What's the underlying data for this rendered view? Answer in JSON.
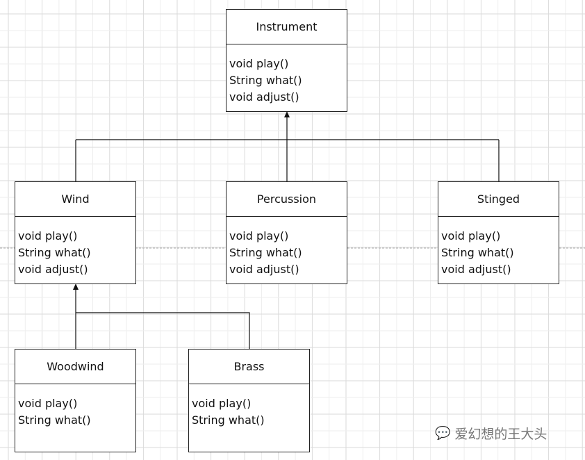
{
  "classes": [
    {
      "id": "instrument",
      "name": "Instrument",
      "methods": [
        "void play()",
        "String what()",
        "void adjust()"
      ]
    },
    {
      "id": "wind",
      "name": "Wind",
      "methods": [
        "void play()",
        "String what()",
        "void adjust()"
      ]
    },
    {
      "id": "percussion",
      "name": "Percussion",
      "methods": [
        "void play()",
        "String what()",
        "void adjust()"
      ]
    },
    {
      "id": "stinged",
      "name": "Stinged",
      "methods": [
        "void play()",
        "String what()",
        "void adjust()"
      ]
    },
    {
      "id": "woodwind",
      "name": "Woodwind",
      "methods": [
        "void play()",
        "String what()"
      ]
    },
    {
      "id": "brass",
      "name": "Brass",
      "methods": [
        "void play()",
        "String what()"
      ]
    }
  ],
  "relations": [
    {
      "from": "wind",
      "to": "instrument",
      "type": "inheritance"
    },
    {
      "from": "percussion",
      "to": "instrument",
      "type": "inheritance"
    },
    {
      "from": "stinged",
      "to": "instrument",
      "type": "inheritance"
    },
    {
      "from": "woodwind",
      "to": "wind",
      "type": "inheritance"
    },
    {
      "from": "brass",
      "to": "wind",
      "type": "inheritance"
    }
  ],
  "watermark": {
    "text": "爱幻想的王大头",
    "icon": "wechat-icon"
  }
}
